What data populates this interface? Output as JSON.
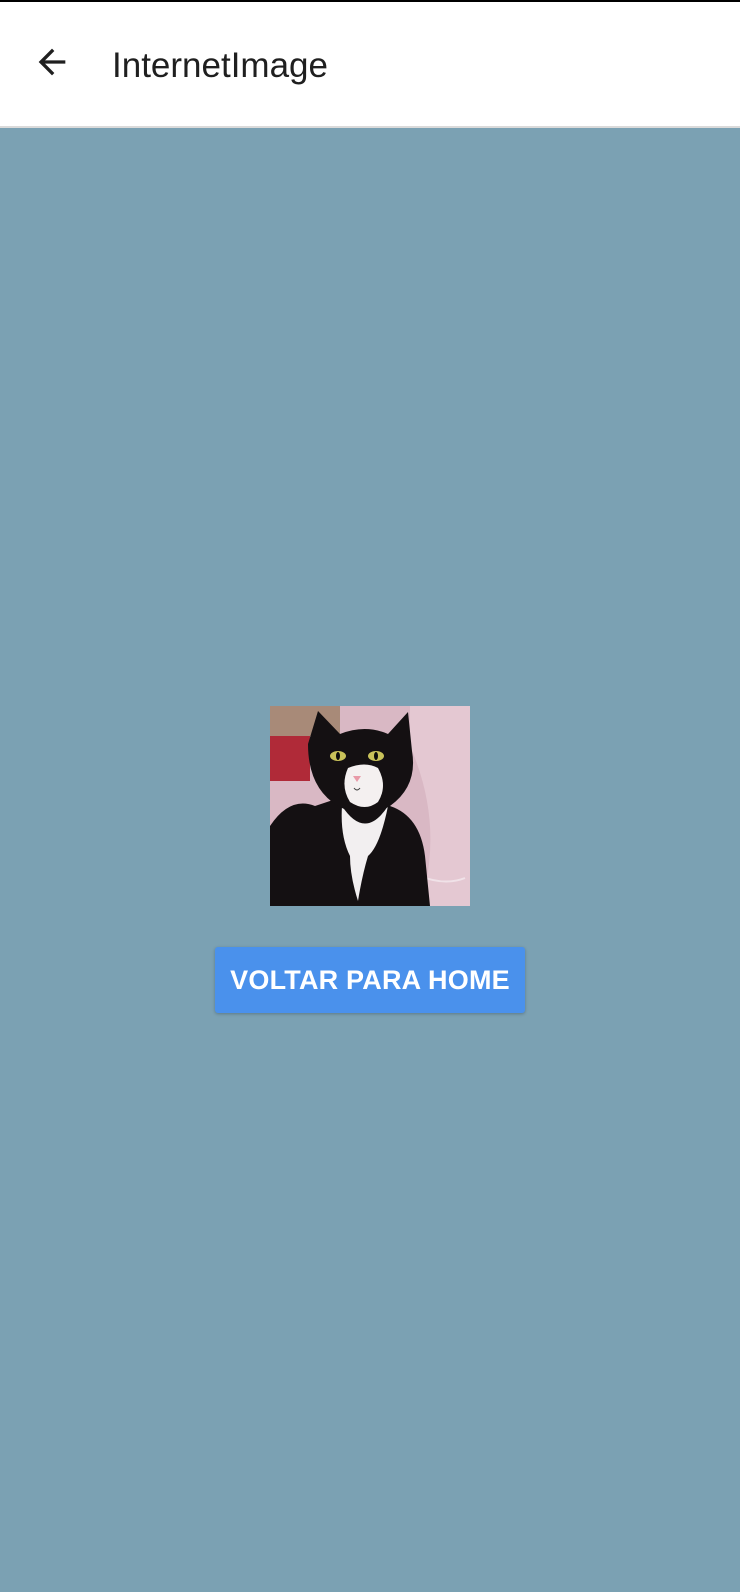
{
  "app_bar": {
    "back_icon": "arrow-left-icon",
    "title": "InternetImage"
  },
  "main": {
    "image_icon": "cat-photo",
    "home_button_label": "VOLTAR PARA HOME"
  },
  "colors": {
    "background": "#7ba1b3",
    "app_bar": "#ffffff",
    "button": "#4a91ec",
    "button_text": "#ffffff",
    "title_text": "#1f1f1f"
  }
}
